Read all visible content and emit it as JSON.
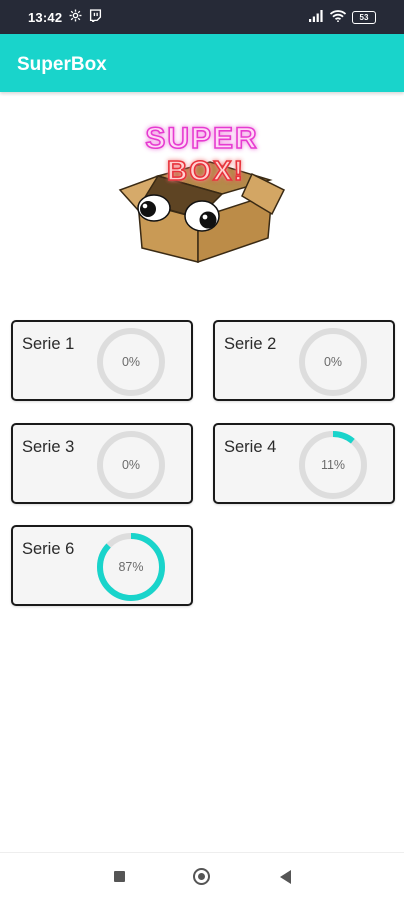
{
  "status_bar": {
    "time": "13:42",
    "battery": "53",
    "icons": [
      "settings-icon",
      "twitch-icon",
      "signal-icon",
      "wifi-icon",
      "battery-icon"
    ]
  },
  "app": {
    "title": "SuperBox",
    "accent_color": "#19d4cb"
  },
  "logo": {
    "alt": "SUPER BOX!",
    "line1": "SUPER",
    "line2": "BOX!"
  },
  "series": [
    {
      "label": "Serie 1",
      "progress": 0,
      "percent_text": "0%"
    },
    {
      "label": "Serie 2",
      "progress": 0,
      "percent_text": "0%"
    },
    {
      "label": "Serie 3",
      "progress": 0,
      "percent_text": "0%"
    },
    {
      "label": "Serie 4",
      "progress": 11,
      "percent_text": "11%"
    },
    {
      "label": "Serie 6",
      "progress": 87,
      "percent_text": "87%"
    }
  ],
  "nav": {
    "icons": [
      "recents-icon",
      "home-icon",
      "back-icon"
    ]
  }
}
